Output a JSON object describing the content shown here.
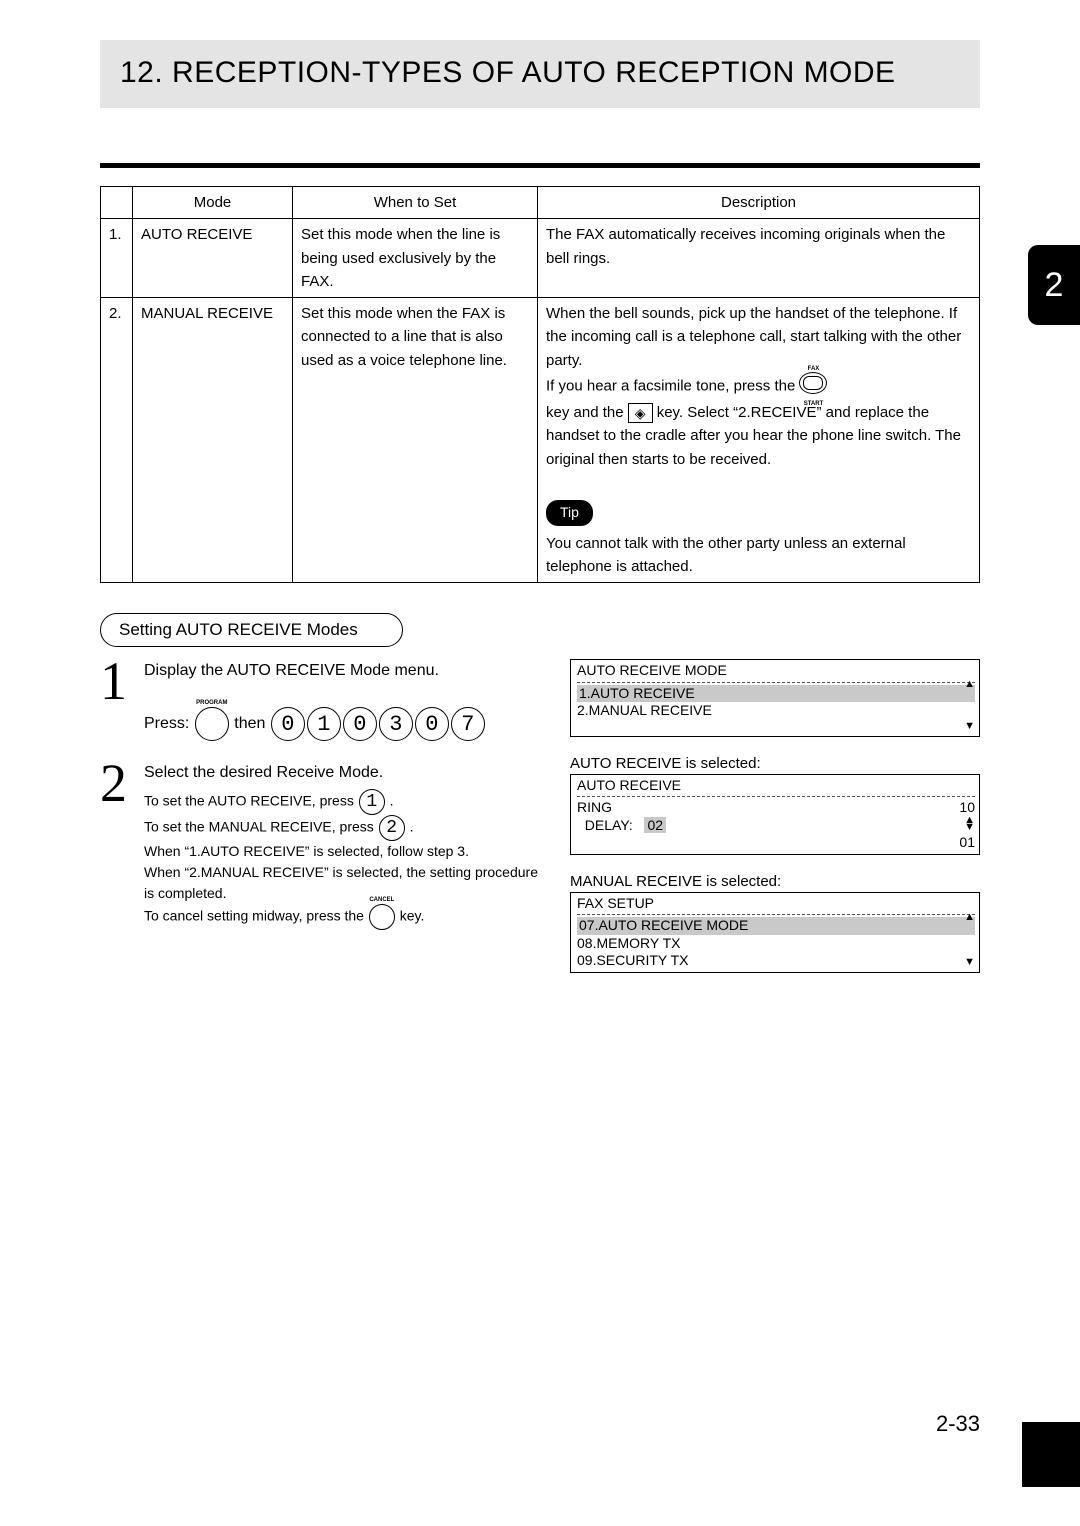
{
  "tabs": {
    "chapter": "2"
  },
  "title": "12. RECEPTION-TYPES OF AUTO RECEPTION MODE",
  "table": {
    "headers": {
      "mode": "Mode",
      "when": "When to Set",
      "desc": "Description"
    },
    "rows": [
      {
        "num": "1.",
        "mode": "AUTO RECEIVE",
        "when": "Set this mode when the line is being used exclusively by the FAX.",
        "desc": "The FAX automatically receives incoming originals when the bell rings."
      },
      {
        "num": "2.",
        "mode": "MANUAL RECEIVE",
        "when": "Set this mode when the FAX is connected to a line that is also used as a voice telephone line.",
        "desc": {
          "p1": "When the bell sounds, pick up the handset of the telephone. If the incoming call is a telephone call, start talking with the other party.",
          "p2a": "If you hear a facsimile tone, press the ",
          "fax_top": "FAX",
          "fax_bottom": "START",
          "p3a": "key and the ",
          "start_key": "◈",
          "p3b": " key. Select “2.RECEIVE” and replace the handset to the cradle after you hear the phone line switch. The original then starts to be received.",
          "tip_label": "Tip",
          "tip_text": "You cannot talk with the other party unless an external telephone is attached."
        }
      }
    ]
  },
  "subhead": "Setting AUTO RECEIVE Modes",
  "steps": {
    "s1": {
      "num": "1",
      "text": "Display the AUTO RECEIVE Mode menu.",
      "press": "Press:",
      "program": "PROGRAM",
      "then": "then",
      "keys": [
        "0",
        "1",
        "0",
        "3",
        "0",
        "7"
      ]
    },
    "s2": {
      "num": "2",
      "text": "Select the desired Receive Mode.",
      "line_auto_a": "To set the AUTO RECEIVE, press ",
      "key_auto": "1",
      "dot": ".",
      "line_man_a": "To set the MANUAL RECEIVE, press ",
      "key_man": "2",
      "line3": "When “1.AUTO RECEIVE” is selected, follow step 3.",
      "line4": "When “2.MANUAL RECEIVE” is selected, the setting procedure is completed.",
      "cancel_a": "To cancel setting midway, press the ",
      "cancel_top": "CANCEL",
      "cancel_b": " key."
    }
  },
  "displays": {
    "d1": {
      "title": "AUTO RECEIVE MODE",
      "hl": "1.AUTO RECEIVE",
      "line2": "2.MANUAL RECEIVE"
    },
    "d2": {
      "label": "AUTO RECEIVE is selected:",
      "title": "AUTO RECEIVE",
      "ring_l": "RING",
      "ring_v": "10",
      "delay_l": "DELAY:",
      "delay_v": "02",
      "foot": "01"
    },
    "d3": {
      "label": "MANUAL RECEIVE is selected:",
      "title": "FAX SETUP",
      "hl": "07.AUTO RECEIVE MODE",
      "l2": "08.MEMORY TX",
      "l3": "09.SECURITY TX"
    }
  },
  "footer": "2-33"
}
